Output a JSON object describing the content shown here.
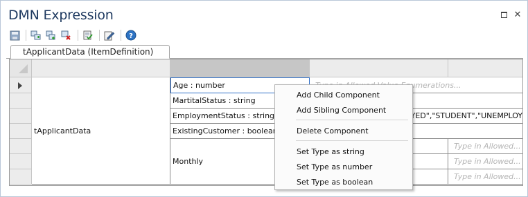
{
  "window": {
    "title": "DMN Expression",
    "maximize_icon": "maximize-icon",
    "close_label": "✕"
  },
  "toolbar": {
    "buttons": [
      {
        "name": "save-icon"
      },
      {
        "name": "add-child-icon"
      },
      {
        "name": "add-sibling-icon"
      },
      {
        "name": "delete-icon"
      },
      {
        "name": "validate-icon"
      },
      {
        "name": "edit-icon"
      },
      {
        "name": "help-icon"
      }
    ]
  },
  "tab": {
    "label": "tApplicantData (ItemDefinition)"
  },
  "grid": {
    "root_label": "tApplicantData",
    "components": [
      "Age : number",
      "MartitalStatus : string",
      "EmploymentStatus : string",
      "ExistingCustomer : boolean",
      "Monthly"
    ],
    "allowed_values_placeholder": "Type in Allowed Value Enumerations...",
    "employment_values": "YED\",\"STUDENT\",\"UNEMPLOY",
    "nested_placeholders": [
      "Type in Allowed...",
      "Type in Allowed...",
      "Type in Allowed..."
    ]
  },
  "context_menu": {
    "items": [
      "Add Child Component",
      "Add Sibling Component",
      "Delete Component",
      "Set Type as string",
      "Set Type as number",
      "Set Type as boolean"
    ]
  },
  "colors": {
    "title": "#1f3a60",
    "selection_border": "#2f6ec8",
    "header_bg": "#ececec"
  }
}
